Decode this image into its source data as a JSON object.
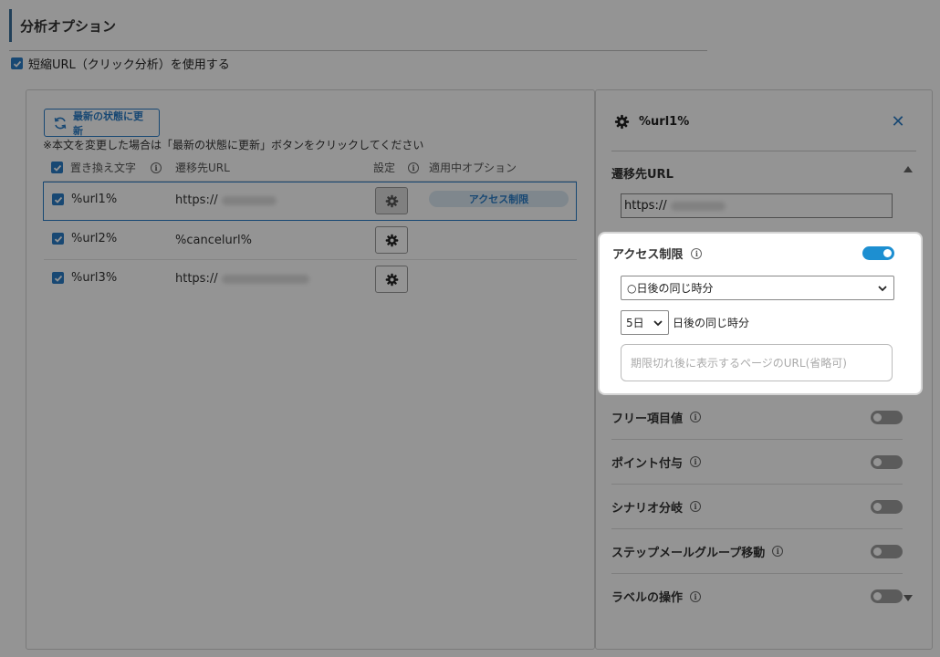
{
  "section": {
    "title": "分析オプション"
  },
  "shorten": {
    "label": "短縮URL（クリック分析）を使用する",
    "checked": true
  },
  "left": {
    "refresh_label": "最新の状態に更新",
    "note": "※本文を変更した場合は「最新の状態に更新」ボタンをクリックしてください",
    "headers": {
      "replace": "置き換え文字",
      "dest": "遷移先URL",
      "settings": "設定",
      "applied": "適用中オプション"
    },
    "rows": [
      {
        "key": "%url1%",
        "url": "https://",
        "applied": "アクセス制限"
      },
      {
        "key": "%url2%",
        "url": "%cancelurl%",
        "applied": ""
      },
      {
        "key": "%url3%",
        "url": "https://",
        "applied": ""
      }
    ]
  },
  "right": {
    "title": "%url1%",
    "close_icon": "close-icon",
    "dest_label": "遷移先URL",
    "dest_value": "https://",
    "access": {
      "label": "アクセス制限",
      "enabled": true,
      "mode_selected": "○日後の同じ時分",
      "days_selected": "5日",
      "days_suffix": "日後の同じ時分",
      "expire_placeholder": "期限切れ後に表示するページのURL(省略可)"
    },
    "options": [
      {
        "label": "フリー項目値",
        "enabled": false
      },
      {
        "label": "ポイント付与",
        "enabled": false
      },
      {
        "label": "シナリオ分岐",
        "enabled": false
      },
      {
        "label": "ステップメールグループ移動",
        "enabled": false
      },
      {
        "label": "ラベルの操作",
        "enabled": false
      }
    ]
  },
  "colors": {
    "accent": "#2a7cc7",
    "toggle_on": "#1d8fd1",
    "overlay": "rgba(0,0,0,0.42)"
  }
}
